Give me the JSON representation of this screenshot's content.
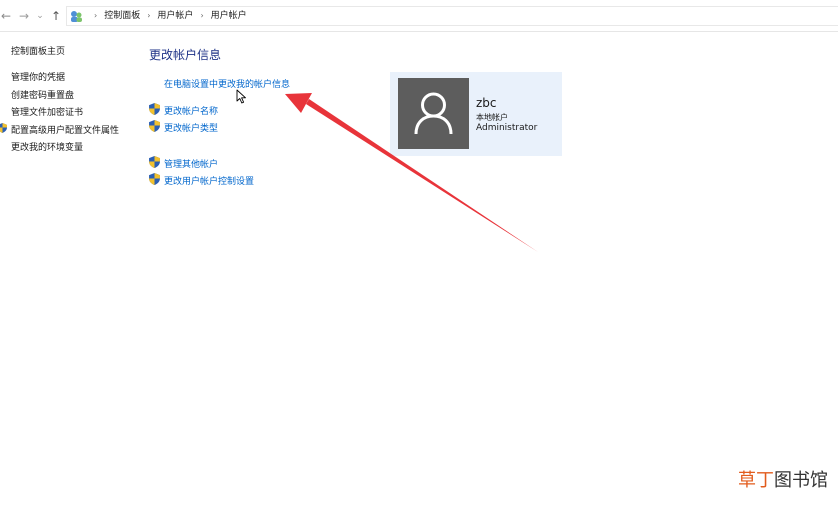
{
  "address_bar": {
    "back_glyph": "←",
    "forward_glyph": "→",
    "dropdown_glyph": "⌄",
    "up_glyph": "↑",
    "crumbs": [
      "控制面板",
      "用户帐户",
      "用户帐户"
    ],
    "separator": "›"
  },
  "sidebar": {
    "home": "控制面板主页",
    "items": [
      {
        "label": "管理你的凭据"
      },
      {
        "label": "创建密码重置盘"
      },
      {
        "label": "管理文件加密证书"
      },
      {
        "label": "配置高级用户配置文件属性",
        "icon": "shield-icon"
      },
      {
        "label": "更改我的环境变量"
      }
    ]
  },
  "main": {
    "title": "更改帐户信息",
    "settings_link": "在电脑设置中更改我的帐户信息",
    "links_group1": [
      {
        "label": "更改帐户名称",
        "icon": "shield-icon"
      },
      {
        "label": "更改帐户类型",
        "icon": "shield-icon"
      }
    ],
    "links_group2": [
      {
        "label": "管理其他帐户",
        "icon": "shield-icon"
      },
      {
        "label": "更改用户帐户控制设置",
        "icon": "shield-icon"
      }
    ]
  },
  "account": {
    "name": "zbc",
    "type": "本地帐户",
    "role": "Administrator"
  },
  "watermark": {
    "accent": "草丁",
    "rest": "图书馆"
  },
  "colors": {
    "link": "#0066cc",
    "title": "#1e3287",
    "card_bg": "#e9f1fb",
    "avatar_bg": "#5d5d5d",
    "annotation_arrow": "#e8343a"
  }
}
